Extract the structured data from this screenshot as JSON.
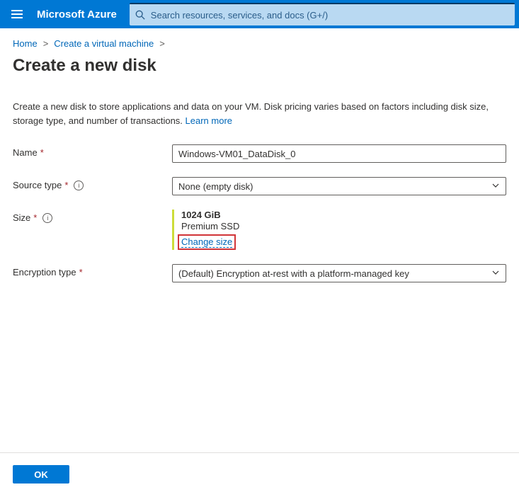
{
  "header": {
    "brand": "Microsoft Azure",
    "search_placeholder": "Search resources, services, and docs (G+/)"
  },
  "breadcrumb": {
    "items": [
      "Home",
      "Create a virtual machine"
    ]
  },
  "page": {
    "title": "Create a new disk",
    "description": "Create a new disk to store applications and data on your VM. Disk pricing varies based on factors including disk size, storage type, and number of transactions.  ",
    "learn_more": "Learn more"
  },
  "form": {
    "name_label": "Name",
    "name_value": "Windows-VM01_DataDisk_0",
    "source_label": "Source type",
    "source_value": "None (empty disk)",
    "size_label": "Size",
    "size_value": "1024 GiB",
    "size_tier": "Premium SSD",
    "change_size": "Change size",
    "encryption_label": "Encryption type",
    "encryption_value": "(Default) Encryption at-rest with a platform-managed key"
  },
  "footer": {
    "ok": "OK"
  }
}
